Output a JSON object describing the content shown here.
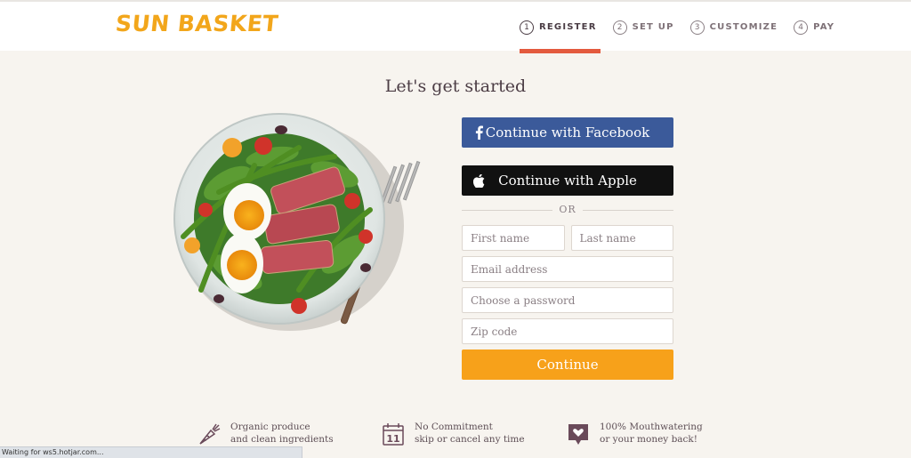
{
  "header": {
    "logo": "SUN BASKET",
    "steps": [
      {
        "num": "1",
        "label": "REGISTER"
      },
      {
        "num": "2",
        "label": "SET UP"
      },
      {
        "num": "3",
        "label": "CUSTOMIZE"
      },
      {
        "num": "4",
        "label": "PAY"
      }
    ],
    "active_step": 1
  },
  "main": {
    "title": "Let's get started"
  },
  "form": {
    "facebook_label": "Continue with Facebook",
    "apple_label": "Continue with Apple",
    "or_label": "OR",
    "first_name_placeholder": "First name",
    "last_name_placeholder": "Last name",
    "email_placeholder": "Email address",
    "password_placeholder": "Choose a password",
    "zip_placeholder": "Zip code",
    "continue_label": "Continue"
  },
  "benefits": [
    {
      "icon": "carrot-icon",
      "line1": "Organic produce",
      "line2": "and clean ingredients"
    },
    {
      "icon": "calendar-icon",
      "line1": "No Commitment",
      "line2": "skip or cancel any time"
    },
    {
      "icon": "heart-bag-icon",
      "line1": "100% Mouthwatering",
      "line2": "or your money back!"
    }
  ],
  "status_bar": {
    "text": "Waiting for ws5.hotjar.com..."
  },
  "colors": {
    "brand": "#f2a61b",
    "accent": "#e35a3e",
    "facebook": "#3b5a9a",
    "apple": "#111111",
    "continue": "#f7a11a",
    "background": "#f7f4ef"
  }
}
